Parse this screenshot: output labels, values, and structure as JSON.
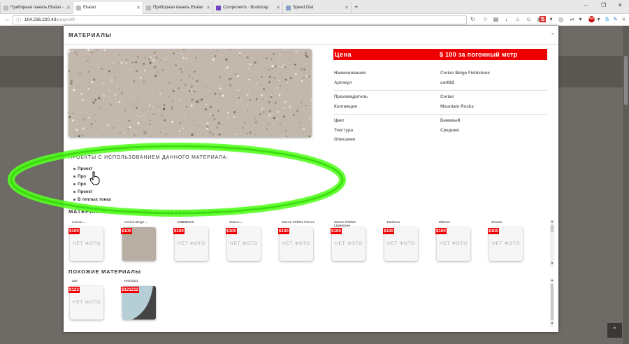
{
  "browser": {
    "tabs": [
      {
        "label": "Приборная панель Ekalan - ...",
        "active": false,
        "icon": "page-icon"
      },
      {
        "label": "Ekalan",
        "active": true,
        "icon": "page-icon"
      },
      {
        "label": "Приборная панель Ekalan",
        "active": false,
        "icon": "page-icon"
      },
      {
        "label": "Components · Bootstrap",
        "active": false,
        "icon": "bootstrap-icon"
      },
      {
        "label": "Speed Dial",
        "active": false,
        "icon": "speed-dial-icon"
      }
    ],
    "new_tab": "+",
    "url_host": "104.236.220.43",
    "url_path": "/project/9",
    "window_buttons": [
      "–",
      "❐",
      "✕"
    ]
  },
  "modal": {
    "title": "МАТЕРИАЛЫ",
    "close": "×",
    "price_label": "Цена",
    "price_value": "$ 100 за погонный метр",
    "properties": [
      {
        "label": "Наименование",
        "value": "Corian Beige Fieldstone"
      },
      {
        "label": "Артикул",
        "value": "cor062"
      },
      {
        "label": "Производитель",
        "value": "Corian"
      },
      {
        "label": "Коллекция",
        "value": "Mountain Rocks"
      },
      {
        "label": "Цвет",
        "value": "Бежевый"
      },
      {
        "label": "Текстура",
        "value": "Средняя"
      },
      {
        "label": "Описание",
        "value": ""
      }
    ],
    "projects_title": "ПРОЕКТЫ С ИСПОЛЬЗОВАНИЕМ ДАННОГО МАТЕРИАЛА:",
    "projects": [
      "Проект",
      "Про",
      "Про",
      "Проект",
      "В теплых тонах"
    ],
    "similar_title": "МАТЕРИАЛЫ СО СХОЖИМИ ХАРАКТЕРИСТИКАМИ",
    "similar": [
      {
        "name": "Corian ...",
        "price": "$100",
        "photo": "НЕТ ФОТО",
        "kind": "none"
      },
      {
        "name": "Corian Beige ...",
        "price": "$100",
        "photo": "",
        "kind": "stone"
      },
      {
        "name": "AMBIENCE",
        "price": "$100",
        "photo": "НЕТ ФОТО",
        "kind": "none"
      },
      {
        "name": "Staron ...",
        "price": "$100",
        "photo": "НЕТ ФОТО",
        "kind": "none"
      },
      {
        "name": "Staron Pebble Fresco",
        "price": "$100",
        "photo": "НЕТ ФОТО",
        "kind": "none"
      },
      {
        "name": "Staron Pebble Limestone",
        "price": "$100",
        "photo": "НЕТ ФОТО",
        "kind": "none"
      },
      {
        "name": "Tambora",
        "price": "$100",
        "photo": "НЕТ ФОТО",
        "kind": "none"
      },
      {
        "name": "Mikeno",
        "price": "$100",
        "photo": "НЕТ ФОТО",
        "kind": "none"
      },
      {
        "name": "Shasta",
        "price": "$100",
        "photo": "НЕТ ФОТО",
        "kind": "none"
      }
    ],
    "like_title": "ПОХОЖИЕ МАТЕРИАЛЫ",
    "like": [
      {
        "name": "ааа",
        "price": "$123",
        "photo": "НЕТ ФОТО",
        "kind": "none"
      },
      {
        "name": "test11111",
        "price": "$121212",
        "photo": "",
        "kind": "blue"
      }
    ]
  },
  "scroll_top_icon": "chevron-up-icon",
  "colors": {
    "price_red": "#ee0000",
    "highlight_green": "#55ff22",
    "overlay": "#6e6a66"
  }
}
